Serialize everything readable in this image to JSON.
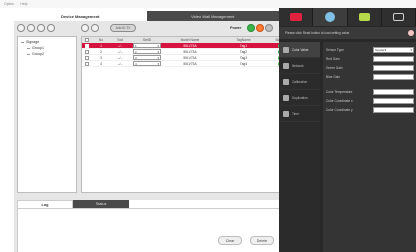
{
  "menubar": {
    "items": [
      "Option",
      "Help"
    ]
  },
  "main_tabs": [
    "Device Management",
    "Video Wall Management"
  ],
  "tree": {
    "root": "Signage",
    "children": [
      "Group1",
      "Group2"
    ]
  },
  "toolbar": {
    "pill_label": "Add ID TV",
    "power_label": "Power"
  },
  "table": {
    "columns": [
      "",
      "No",
      "Tool",
      "SetID",
      "Model Name",
      "TagName",
      "Status"
    ],
    "rows": [
      {
        "no": "1",
        "tool": "--/--",
        "setid": "1",
        "model": "55LV75A",
        "tag": "Tag1",
        "selected": true
      },
      {
        "no": "2",
        "tool": "--/--",
        "setid": "2",
        "model": "55LV75A",
        "tag": "Tag2",
        "selected": false
      },
      {
        "no": "3",
        "tool": "--/--",
        "setid": "3",
        "model": "55LV75A",
        "tag": "Tag3",
        "selected": false
      },
      {
        "no": "4",
        "tool": "--/--",
        "setid": "4",
        "model": "55LV75A",
        "tag": "Tag4",
        "selected": false
      }
    ]
  },
  "log_tabs": [
    "Log",
    "Status"
  ],
  "buttons": {
    "clear": "Clear",
    "delete": "Delete"
  },
  "right_panel": {
    "tab_icons": [
      "tv-icon",
      "globe-icon",
      "envelope-icon",
      "mail-icon"
    ],
    "notice": "Please click Read button to load setting value",
    "side_menu": [
      "Color Value",
      "Network",
      "Calibration",
      "Duplication",
      "Time"
    ],
    "form": {
      "rows": [
        {
          "label": "Sensor Type",
          "value": "Spyder3",
          "dropdown": true
        },
        {
          "label": "Red Gain",
          "value": ""
        },
        {
          "label": "Green Gain",
          "value": ""
        },
        {
          "label": "Blue Gain",
          "value": ""
        },
        {
          "label": "",
          "value": "",
          "separator": true
        },
        {
          "label": "Color Temperature",
          "value": ""
        },
        {
          "label": "Color Coordinate x",
          "value": ""
        },
        {
          "label": "Color Coordinate y",
          "value": ""
        }
      ]
    }
  },
  "colors": {
    "selected_row": "#d6123e",
    "power_on": "#39b54a",
    "power_off": "#ff7a2e",
    "dark_panel": "#282828"
  }
}
